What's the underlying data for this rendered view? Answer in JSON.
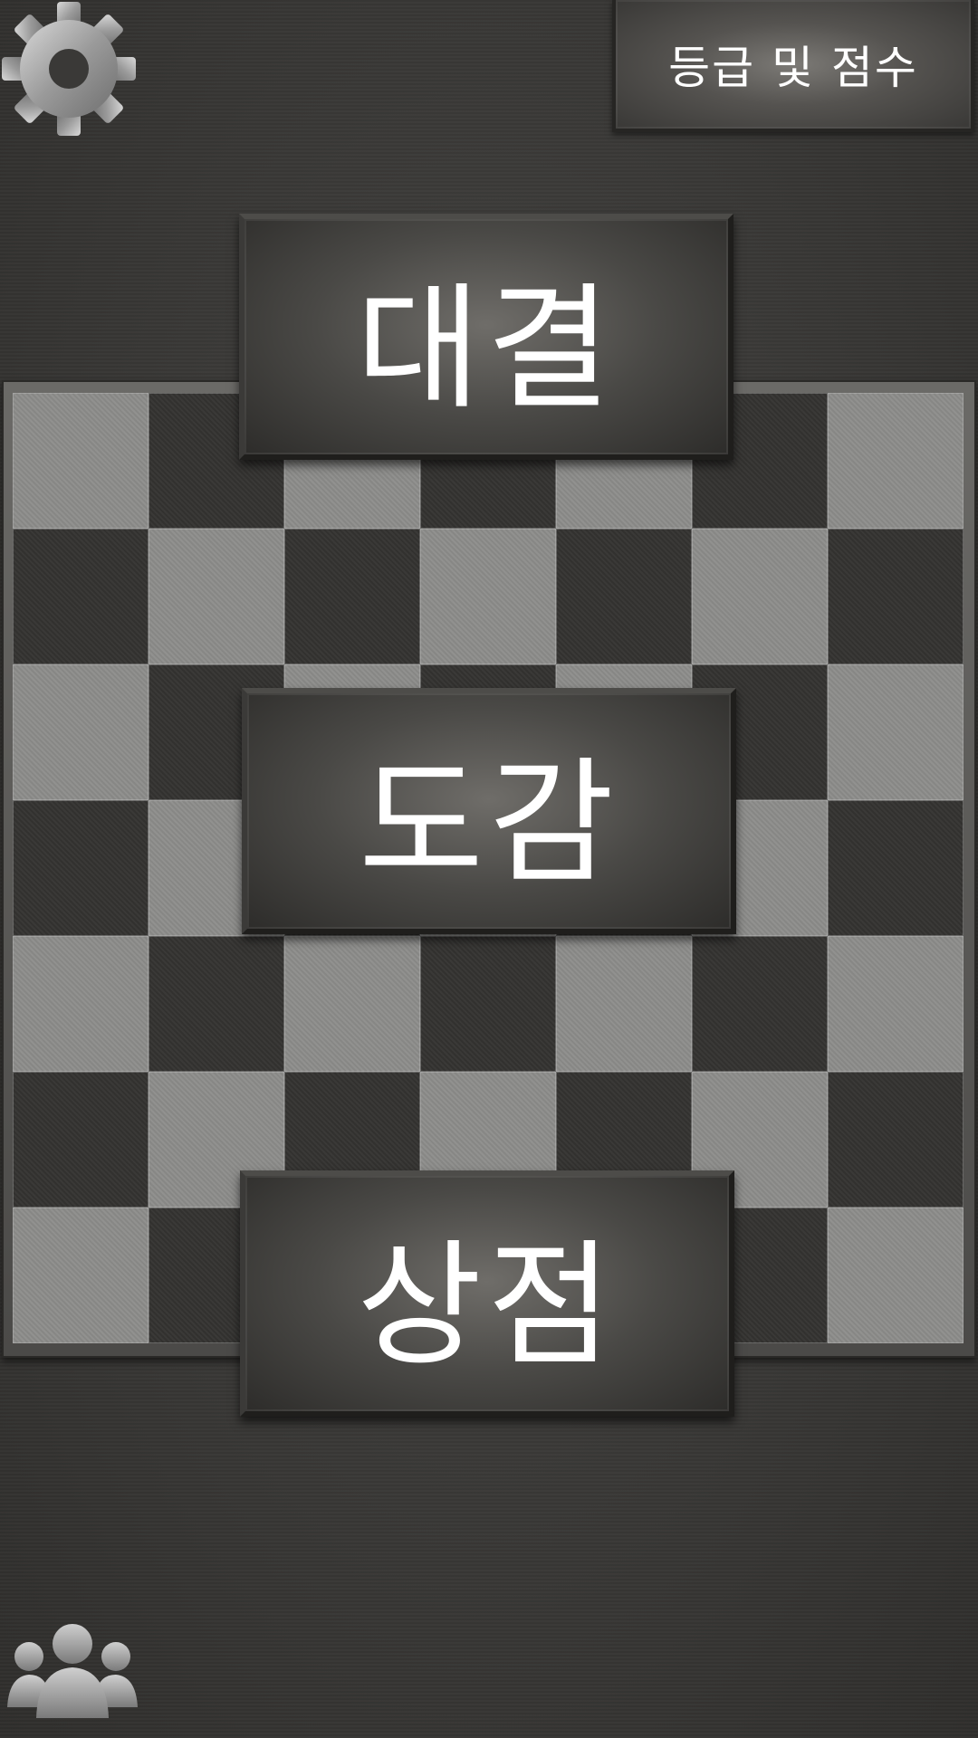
{
  "top_bar": {
    "settings_icon": "gear-icon",
    "rank_button_label": "등급 및 점수"
  },
  "menu": {
    "battle_label": "대결",
    "collection_label": "도감",
    "shop_label": "상점"
  },
  "bottom_bar": {
    "friends_icon": "people-group-icon"
  },
  "board": {
    "rows": 7,
    "cols": 7,
    "top_left_square": "light"
  },
  "colors": {
    "background": "#3b3a38",
    "light_square": "#8d8c8a",
    "dark_square": "#353432",
    "button_text": "#ffffff"
  }
}
